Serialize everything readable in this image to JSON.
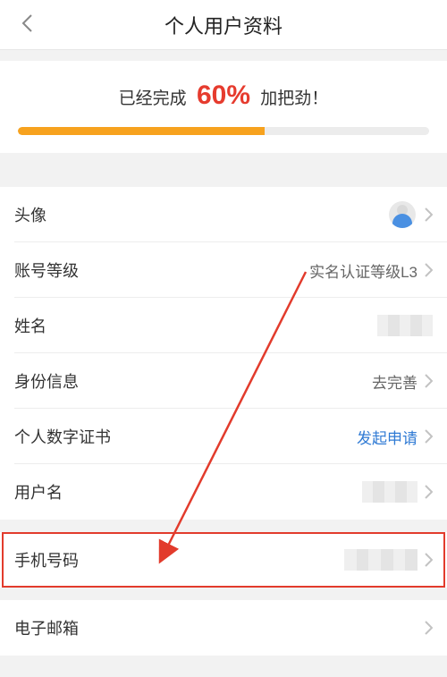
{
  "header": {
    "title": "个人用户资料"
  },
  "progress": {
    "prefix": "已经完成",
    "percent_text": "60%",
    "percent_value": 60,
    "suffix": "加把劲！"
  },
  "rows": {
    "avatar": {
      "label": "头像"
    },
    "level": {
      "label": "账号等级",
      "value": "实名认证等级L3"
    },
    "name": {
      "label": "姓名"
    },
    "identity": {
      "label": "身份信息",
      "value": "去完善"
    },
    "cert": {
      "label": "个人数字证书",
      "value": "发起申请"
    },
    "username": {
      "label": "用户名"
    },
    "phone": {
      "label": "手机号码"
    },
    "email": {
      "label": "电子邮箱"
    }
  },
  "colors": {
    "accent_red": "#e63b2e",
    "accent_orange": "#f7a21e",
    "accent_blue": "#2f7ad4",
    "highlight_border": "#e23b2c"
  }
}
